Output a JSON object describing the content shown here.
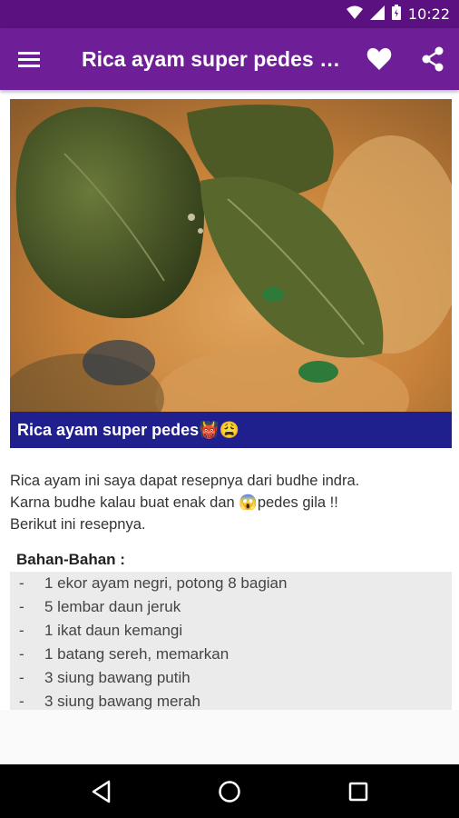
{
  "status_bar": {
    "time": "10:22"
  },
  "app_bar": {
    "title": "Rica ayam super pedes Rica ayam super pedes"
  },
  "hero": {
    "caption": "Rica ayam super pedes👹😩"
  },
  "intro": {
    "line1": "Rica ayam ini saya dapat resepnya dari budhe indra.",
    "line2": "Karna budhe kalau buat enak dan 😱pedes gila !!",
    "line3": "Berikut ini resepnya."
  },
  "ingredients": {
    "heading": "Bahan-Bahan :",
    "items": [
      "1 ekor ayam negri, potong 8 bagian",
      "5 lembar daun jeruk",
      "1 ikat daun kemangi",
      "1 batang sereh, memarkan",
      "3 siung bawang putih",
      "3 siung bawang merah"
    ]
  },
  "colors": {
    "status_bar": "#5b1180",
    "app_bar": "#6e1e96",
    "caption_bg": "#1f1f8e"
  }
}
